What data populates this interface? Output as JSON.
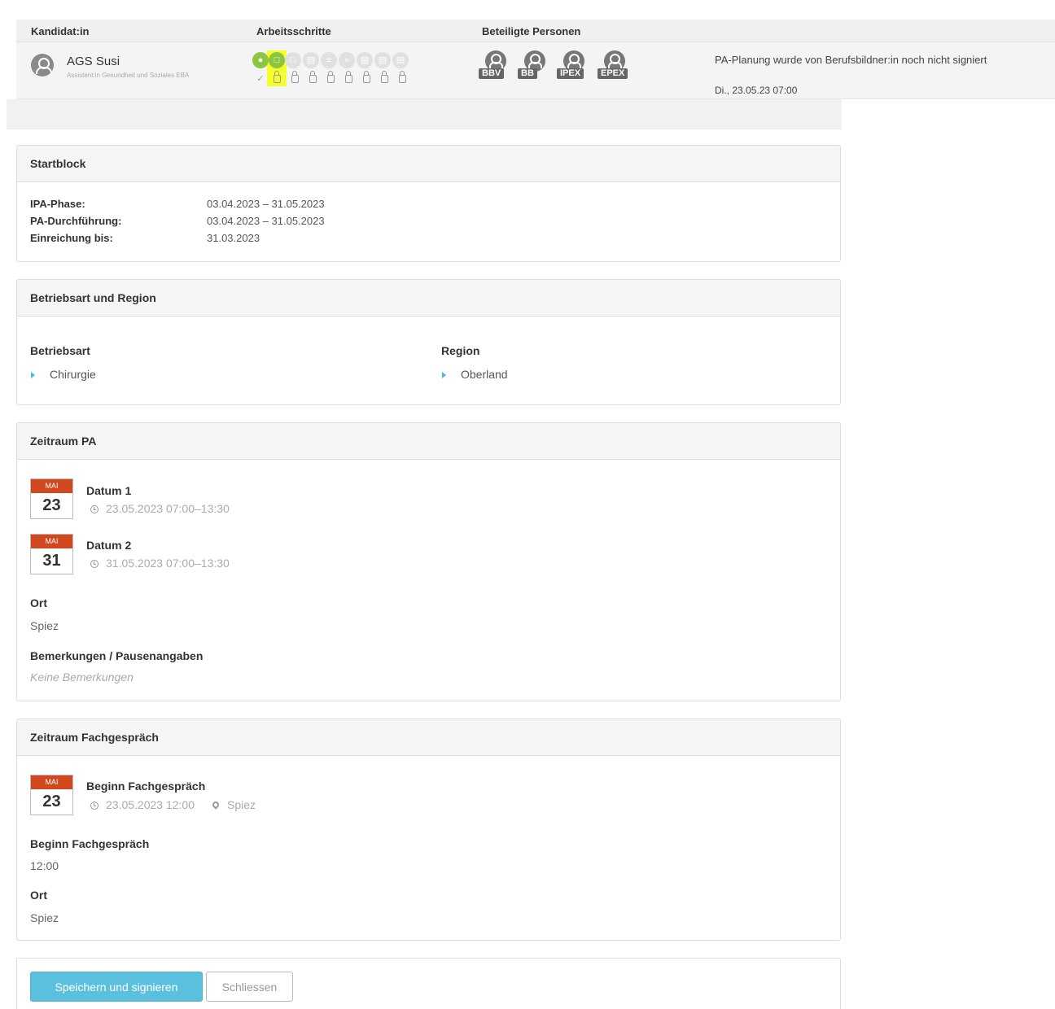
{
  "table": {
    "headers": [
      "Kandidat:in",
      "Arbeitsschritte",
      "Beteiligte Personen"
    ],
    "candidate": {
      "name": "AGS Susi",
      "role": "Assistent:in Gesundheit und Soziales EBA"
    },
    "persons": [
      "BBV",
      "BB",
      "IPEX",
      "EPEX"
    ],
    "status": "PA-Planung wurde von Berufsbildner:in noch nicht signiert",
    "date": "Di., 23.05.23 07:00"
  },
  "startblock": {
    "title": "Startblock",
    "rows": [
      {
        "label": "IPA-Phase:",
        "value": "03.04.2023 – 31.05.2023"
      },
      {
        "label": "PA-Durchführung:",
        "value": "03.04.2023 – 31.05.2023"
      },
      {
        "label": "Einreichung bis:",
        "value": "31.03.2023"
      }
    ]
  },
  "betrieb": {
    "title": "Betriebsart und Region",
    "betriebsart_label": "Betriebsart",
    "betriebsart_value": "Chirurgie",
    "region_label": "Region",
    "region_value": "Oberland"
  },
  "zeitraum_pa": {
    "title": "Zeitraum PA",
    "dates": [
      {
        "month": "MAI",
        "day": "23",
        "title": "Datum 1",
        "time": "23.05.2023 07:00–13:30"
      },
      {
        "month": "MAI",
        "day": "31",
        "title": "Datum 2",
        "time": "31.05.2023 07:00–13:30"
      }
    ],
    "ort_label": "Ort",
    "ort_value": "Spiez",
    "bemerk_label": "Bemerkungen / Pausenangaben",
    "bemerk_value": "Keine Bemerkungen"
  },
  "zeitraum_fg": {
    "title": "Zeitraum Fachgespräch",
    "cal_month": "MAI",
    "cal_day": "23",
    "entry_title": "Beginn Fachgespräch",
    "entry_time": "23.05.2023 12:00",
    "entry_place": "Spiez",
    "beginn_label": "Beginn Fachgespräch",
    "beginn_value": "12:00",
    "ort_label": "Ort",
    "ort_value": "Spiez"
  },
  "actions": {
    "save_sign": "Speichern und signieren",
    "close": "Schliessen"
  },
  "colors": {
    "accent": "#5bc0de",
    "step_done": "#8cc63f",
    "highlight": "#f6ff2e",
    "calendar": "#d2481e"
  }
}
